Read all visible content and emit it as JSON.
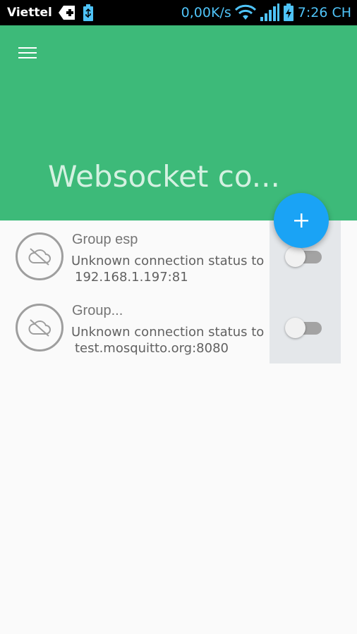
{
  "status_bar": {
    "carrier": "Viettel",
    "net_speed": "0,00K/s",
    "time": "7:26 CH"
  },
  "app_bar": {
    "title": "Websocket co..."
  },
  "fab": {
    "icon": "plus-icon"
  },
  "connections": [
    {
      "title": "Group esp",
      "status_line": "Unknown connection status to",
      "address": "192.168.1.197:81",
      "enabled": false
    },
    {
      "title": "Group...",
      "status_line": "Unknown connection status to",
      "address": "test.mosquitto.org:8080",
      "enabled": false
    }
  ],
  "colors": {
    "app_bar": "#3dba79",
    "fab": "#1aa3f5",
    "status_text": "#4fc3f7"
  }
}
